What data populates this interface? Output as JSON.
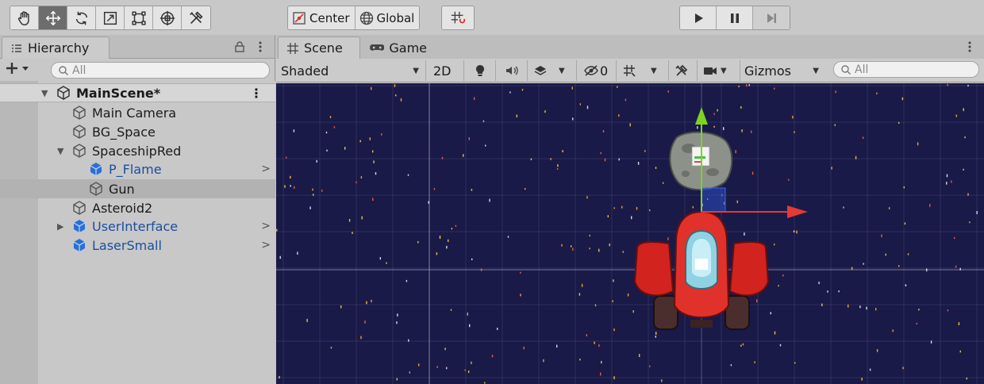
{
  "toolbar": {
    "tools": [
      {
        "name": "hand-tool",
        "active": false
      },
      {
        "name": "move-tool",
        "active": true
      },
      {
        "name": "rotate-tool",
        "active": false
      },
      {
        "name": "scale-tool",
        "active": false
      },
      {
        "name": "rect-tool",
        "active": false
      },
      {
        "name": "transform-tool",
        "active": false
      },
      {
        "name": "custom-tool",
        "active": false
      }
    ],
    "pivot_label": "Center",
    "space_label": "Global",
    "snap_icon": "grid-snap-icon",
    "play_icons": [
      "play-icon",
      "pause-icon",
      "step-icon"
    ]
  },
  "hierarchy": {
    "tab_label": "Hierarchy",
    "search_placeholder": "All",
    "scene_name": "MainScene*",
    "items": [
      {
        "label": "Main Camera",
        "prefab": false
      },
      {
        "label": "BG_Space",
        "prefab": false
      },
      {
        "label": "SpaceshipRed",
        "prefab": false
      },
      {
        "label": "P_Flame",
        "prefab": true
      },
      {
        "label": "Gun",
        "prefab": false
      },
      {
        "label": "Asteroid2",
        "prefab": false
      },
      {
        "label": "UserInterface",
        "prefab": true
      },
      {
        "label": "LaserSmall",
        "prefab": true
      }
    ]
  },
  "scene": {
    "tabs": [
      "Scene",
      "Game"
    ],
    "shading_mode": "Shaded",
    "mode_2d": "2D",
    "hidden_count": "0",
    "gizmos_label": "Gizmos",
    "search_placeholder": "All"
  },
  "colors": {
    "prefab_text": "#1a4fa0",
    "viewport_bg": "#1a1a48",
    "gizmo_x": "#e53935",
    "gizmo_y": "#7ed321"
  }
}
